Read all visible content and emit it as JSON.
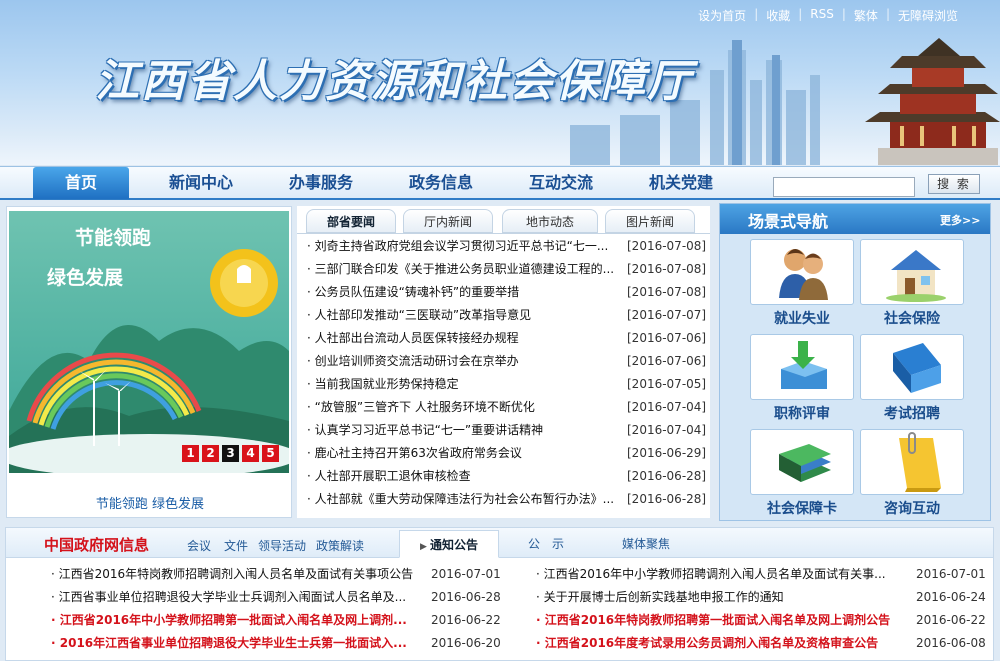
{
  "top_links": [
    "设为首页",
    "收藏",
    "RSS",
    "繁体",
    "无障碍浏览"
  ],
  "site_title": "江西省人力资源和社会保障厅",
  "nav": [
    "首页",
    "新闻中心",
    "办事服务",
    "政务信息",
    "互动交流",
    "机关党建"
  ],
  "search": {
    "button": "搜 索",
    "value": ""
  },
  "banner": {
    "headline_1": "节能领跑",
    "headline_2": "绿色发展",
    "caption": "节能领跑 绿色发展",
    "pages": [
      "1",
      "2",
      "3",
      "4",
      "5"
    ],
    "current_page": 3
  },
  "news": {
    "tabs": [
      "部省要闻",
      "厅内新闻",
      "地市动态",
      "图片新闻"
    ],
    "active_tab": 0,
    "items": [
      {
        "title": "刘奇主持省政府党组会议学习贯彻习近平总书记“七一...",
        "date": "[2016-07-08]"
      },
      {
        "title": "三部门联合印发《关于推进公务员职业道德建设工程的...",
        "date": "[2016-07-08]"
      },
      {
        "title": "公务员队伍建设“铸魂补钙”的重要举措",
        "date": "[2016-07-08]"
      },
      {
        "title": "人社部印发推动“三医联动”改革指导意见",
        "date": "[2016-07-07]"
      },
      {
        "title": "人社部出台流动人员医保转接经办规程",
        "date": "[2016-07-06]"
      },
      {
        "title": "创业培训师资交流活动研讨会在京举办",
        "date": "[2016-07-06]"
      },
      {
        "title": "当前我国就业形势保持稳定",
        "date": "[2016-07-05]"
      },
      {
        "title": "“放管服”三管齐下 人社服务环境不断优化",
        "date": "[2016-07-04]"
      },
      {
        "title": "认真学习习近平总书记“七一”重要讲话精神",
        "date": "[2016-07-04]"
      },
      {
        "title": "鹿心社主持召开第63次省政府常务会议",
        "date": "[2016-06-29]"
      },
      {
        "title": "人社部开展职工退休审核检查",
        "date": "[2016-06-28]"
      },
      {
        "title": "人社部就《重大劳动保障违法行为社会公布暂行办法》...",
        "date": "[2016-06-28]"
      }
    ]
  },
  "scene": {
    "title": "场景式导航",
    "more": "更多>>",
    "items": [
      "就业失业",
      "社会保险",
      "职称评审",
      "考试招聘",
      "社会保障卡",
      "咨询互动"
    ]
  },
  "bottom": {
    "gov_title": "中国政府网信息",
    "gov_links": [
      "会议",
      "文件",
      "领导活动",
      "政策解读"
    ],
    "tabs": [
      "通知公告",
      "公　示",
      "媒体聚焦"
    ],
    "active_tab": 0,
    "left_items": [
      {
        "title": "江西省2016年特岗教师招聘调剂入闱人员名单及面试有关事项公告",
        "date": "2016-07-01",
        "highlight": false
      },
      {
        "title": "江西省事业单位招聘退役大学毕业士兵调剂入闱面试人员名单及...",
        "date": "2016-06-28",
        "highlight": false
      },
      {
        "title": "江西省2016年中小学教师招聘第一批面试入闱名单及网上调剂...",
        "date": "2016-06-22",
        "highlight": true
      },
      {
        "title": "2016年江西省事业单位招聘退役大学毕业生士兵第一批面试入...",
        "date": "2016-06-20",
        "highlight": true
      }
    ],
    "right_items": [
      {
        "title": "江西省2016年中小学教师招聘调剂入闱人员名单及面试有关事...",
        "date": "2016-07-01",
        "highlight": false
      },
      {
        "title": "关于开展博士后创新实践基地申报工作的通知",
        "date": "2016-06-24",
        "highlight": false
      },
      {
        "title": "江西省2016年特岗教师招聘第一批面试入闱名单及网上调剂公告",
        "date": "2016-06-22",
        "highlight": true
      },
      {
        "title": "江西省2016年度考试录用公务员调剂入闱名单及资格审查公告",
        "date": "2016-06-08",
        "highlight": true
      }
    ]
  },
  "colors": {
    "accent": "#2f7cc6",
    "alert": "#d4121b",
    "banner_bg": "#3aa596"
  }
}
